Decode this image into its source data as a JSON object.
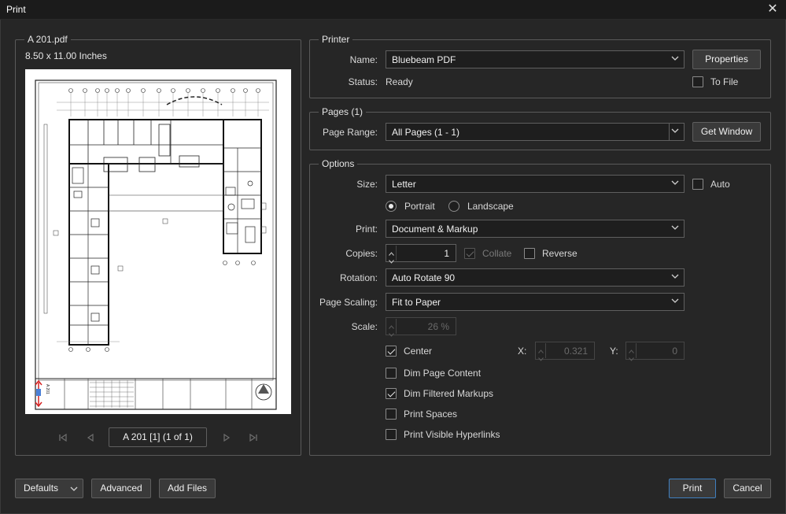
{
  "window": {
    "title": "Print"
  },
  "preview": {
    "file_name": "A 201.pdf",
    "dimensions": "8.50  x  11.00 Inches",
    "page_indicator": "A 201 [1] (1 of 1)"
  },
  "printer": {
    "legend": "Printer",
    "name_label": "Name:",
    "name_value": "Bluebeam PDF",
    "properties_label": "Properties",
    "status_label": "Status:",
    "status_value": "Ready",
    "to_file_label": "To File",
    "to_file_checked": false
  },
  "pages": {
    "legend": "Pages (1)",
    "range_label": "Page Range:",
    "range_value": "All Pages (1 - 1)",
    "get_window_label": "Get Window"
  },
  "options": {
    "legend": "Options",
    "size_label": "Size:",
    "size_value": "Letter",
    "auto_label": "Auto",
    "auto_checked": false,
    "portrait_label": "Portrait",
    "landscape_label": "Landscape",
    "orientation": "Portrait",
    "print_label": "Print:",
    "print_value": "Document & Markup",
    "copies_label": "Copies:",
    "copies_value": "1",
    "collate_label": "Collate",
    "collate_checked": true,
    "reverse_label": "Reverse",
    "reverse_checked": false,
    "rotation_label": "Rotation:",
    "rotation_value": "Auto Rotate 90",
    "page_scaling_label": "Page Scaling:",
    "page_scaling_value": "Fit to Paper",
    "scale_label": "Scale:",
    "scale_value": "26 %",
    "center_label": "Center",
    "center_checked": true,
    "x_label": "X:",
    "x_value": "0.321",
    "y_label": "Y:",
    "y_value": "0",
    "dim_page_content_label": "Dim Page Content",
    "dim_page_content_checked": false,
    "dim_filtered_markups_label": "Dim Filtered Markups",
    "dim_filtered_markups_checked": true,
    "print_spaces_label": "Print Spaces",
    "print_spaces_checked": false,
    "print_visible_hyperlinks_label": "Print Visible Hyperlinks",
    "print_visible_hyperlinks_checked": false
  },
  "footer": {
    "defaults_label": "Defaults",
    "advanced_label": "Advanced",
    "add_files_label": "Add Files",
    "print_label": "Print",
    "cancel_label": "Cancel"
  },
  "drawing_text": {
    "sheet_number": "A 201"
  },
  "colors": {
    "background": "#262626",
    "primary_border": "#3f7fbf",
    "marker_red": "#d62020",
    "marker_blue": "#4a7fd6"
  }
}
